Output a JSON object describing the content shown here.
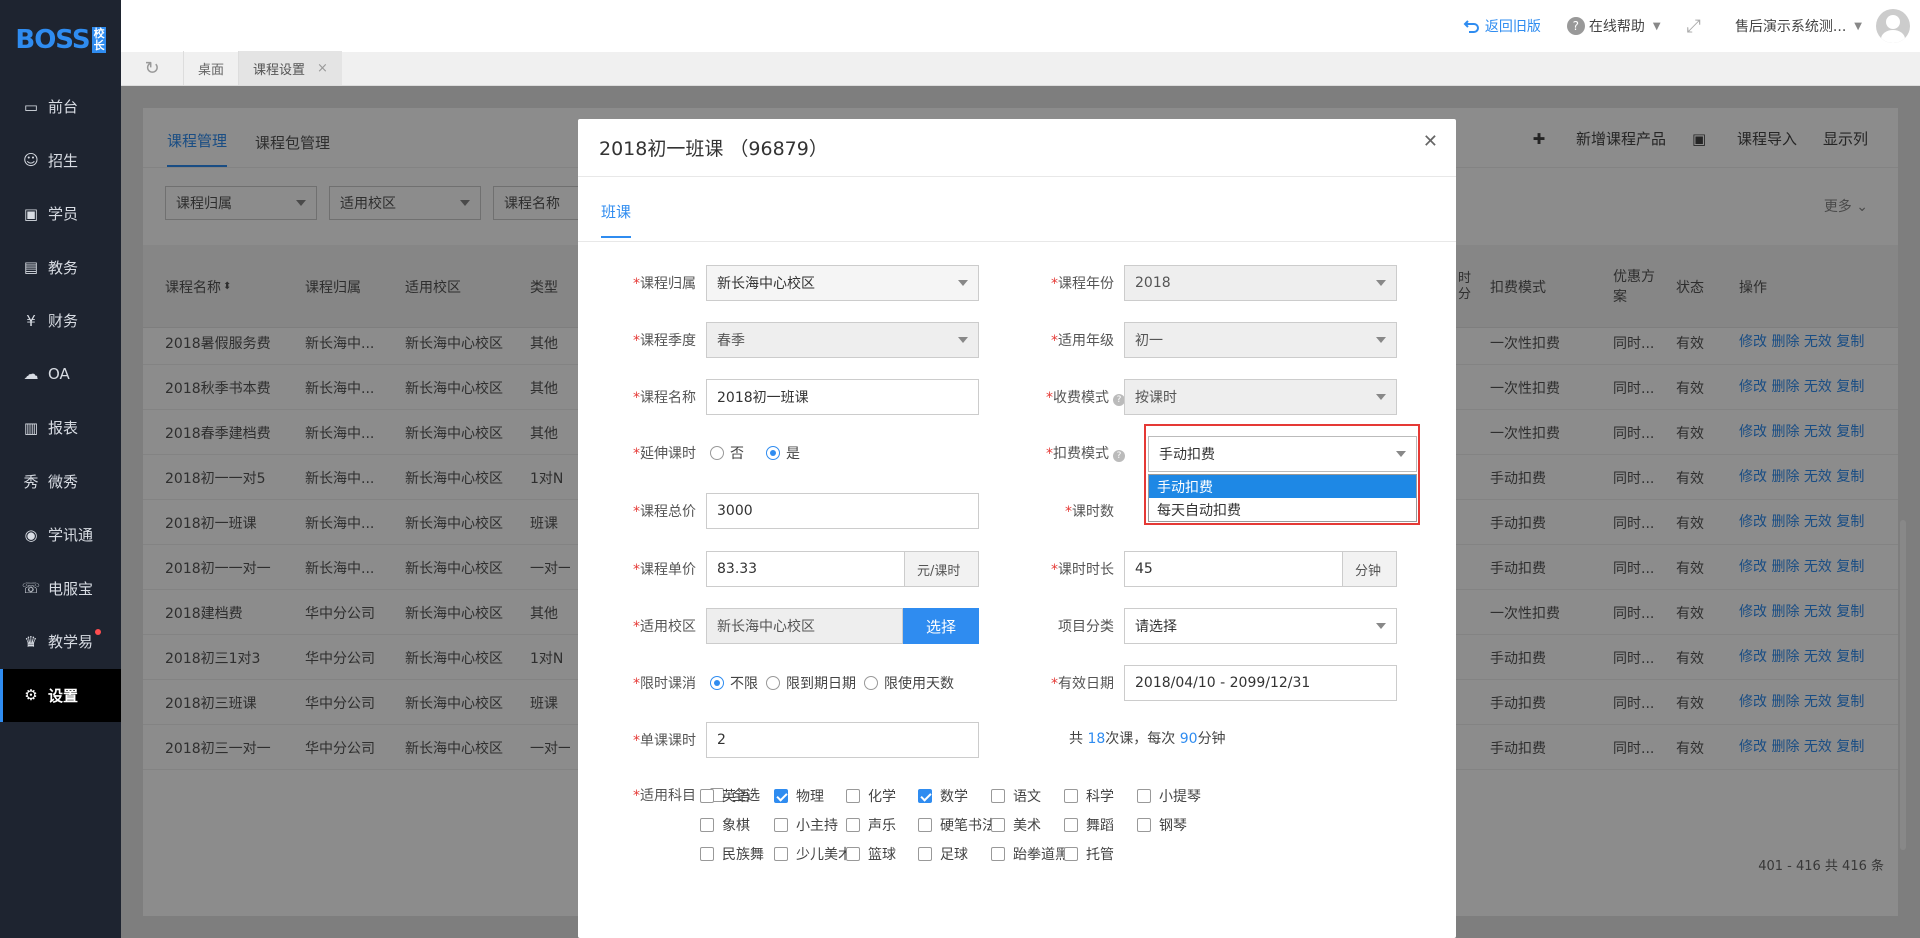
{
  "brand": {
    "logo": "BOSS",
    "logo_sub": "校长"
  },
  "sidebar": {
    "items": [
      {
        "label": "前台",
        "icon": "calendar-icon"
      },
      {
        "label": "招生",
        "icon": "user-add-icon"
      },
      {
        "label": "学员",
        "icon": "id-card-icon"
      },
      {
        "label": "教务",
        "icon": "book-icon"
      },
      {
        "label": "财务",
        "icon": "yen-icon"
      },
      {
        "label": "OA",
        "icon": "cloud-icon"
      },
      {
        "label": "报表",
        "icon": "bar-chart-icon"
      },
      {
        "label": "微秀",
        "icon": "xiu-icon"
      },
      {
        "label": "学讯通",
        "icon": "location-icon"
      },
      {
        "label": "电服宝",
        "icon": "phone-icon"
      },
      {
        "label": "教学易",
        "icon": "graduation-icon"
      },
      {
        "label": "设置",
        "icon": "gear-icon"
      }
    ]
  },
  "topbar": {
    "back": "返回旧版",
    "help": "在线帮助",
    "user": "售后演示系统测..."
  },
  "tabs": [
    {
      "label": "桌面"
    },
    {
      "label": "课程设置"
    }
  ],
  "content": {
    "tabs": [
      "课程管理",
      "课程包管理"
    ],
    "tools": [
      "新增课程产品",
      "课程导入",
      "显示列"
    ],
    "filters": [
      "课程归属",
      "适用校区",
      "课程名称"
    ],
    "more": "更多",
    "columns": [
      "课程名称",
      "课程归属",
      "适用校区",
      "类型",
      "时分",
      "扣费模式",
      "优惠方案",
      "状态",
      "操作"
    ],
    "rows": [
      [
        "2018暑假服务费",
        "新长海中...",
        "新长海中心校区",
        "其他",
        "一次性扣费",
        "同时...",
        "有效"
      ],
      [
        "2018秋季书本费",
        "新长海中...",
        "新长海中心校区",
        "其他",
        "一次性扣费",
        "同时...",
        "有效"
      ],
      [
        "2018春季建档费",
        "新长海中...",
        "新长海中心校区",
        "其他",
        "一次性扣费",
        "同时...",
        "有效"
      ],
      [
        "2018初一一对5",
        "新长海中...",
        "新长海中心校区",
        "1对N",
        "手动扣费",
        "同时...",
        "有效"
      ],
      [
        "2018初一班课",
        "新长海中...",
        "新长海中心校区",
        "班课",
        "手动扣费",
        "同时...",
        "有效"
      ],
      [
        "2018初一一对一",
        "新长海中...",
        "新长海中心校区",
        "一对一",
        "手动扣费",
        "同时...",
        "有效"
      ],
      [
        "2018建档费",
        "华中分公司",
        "新长海中心校区",
        "其他",
        "一次性扣费",
        "同时...",
        "有效"
      ],
      [
        "2018初三1对3",
        "华中分公司",
        "新长海中心校区",
        "1对N",
        "手动扣费",
        "同时...",
        "有效"
      ],
      [
        "2018初三班课",
        "华中分公司",
        "新长海中心校区",
        "班课",
        "手动扣费",
        "同时...",
        "有效"
      ],
      [
        "2018初三一对一",
        "华中分公司",
        "新长海中心校区",
        "一对一",
        "手动扣费",
        "同时...",
        "有效"
      ]
    ],
    "ops": "修改 删除 无效 复制",
    "pager": "401 - 416   共 416 条"
  },
  "modal": {
    "title": "2018初一班课 （96879）",
    "tab": "班课",
    "fields": {
      "owner": {
        "label": "课程归属",
        "value": "新长海中心校区"
      },
      "year": {
        "label": "课程年份",
        "value": "2018"
      },
      "season": {
        "label": "课程季度",
        "value": "春季"
      },
      "grade": {
        "label": "适用年级",
        "value": "初一"
      },
      "name": {
        "label": "课程名称",
        "value": "2018初一班课"
      },
      "fee_mode": {
        "label": "收费模式",
        "value": "按课时"
      },
      "extend": {
        "label": "延伸课时",
        "options": [
          "否",
          "是"
        ],
        "selected": "是"
      },
      "deduct": {
        "label": "扣费模式",
        "value": "手动扣费",
        "options": [
          "手动扣费",
          "每天自动扣费"
        ],
        "highlighted": "手动扣费"
      },
      "total": {
        "label": "课程总价",
        "value": "3000"
      },
      "hours": {
        "label": "课时数",
        "value": ""
      },
      "unit_price": {
        "label": "课程单价",
        "value": "83.33",
        "addon": "元/课时"
      },
      "duration": {
        "label": "课时时长",
        "value": "45",
        "addon": "分钟"
      },
      "campus": {
        "label": "适用校区",
        "value": "新长海中心校区",
        "button": "选择"
      },
      "category": {
        "label": "项目分类",
        "value": "请选择"
      },
      "limit": {
        "label": "限时课消",
        "options": [
          "不限",
          "限到期日期",
          "限使用天数"
        ],
        "selected": "不限"
      },
      "valid": {
        "label": "有效日期",
        "value": "2018/04/10 - 2099/12/31"
      },
      "single": {
        "label": "单课课时",
        "value": "2"
      },
      "summary": {
        "prefix": "共 ",
        "count": "18",
        "mid": "次课，每次 ",
        "minutes": "90",
        "suffix": "分钟"
      },
      "subjects": {
        "label": "适用科目",
        "all": "全选",
        "items": [
          {
            "name": "英语",
            "checked": false
          },
          {
            "name": "物理",
            "checked": true
          },
          {
            "name": "化学",
            "checked": false
          },
          {
            "name": "数学",
            "checked": true
          },
          {
            "name": "语文",
            "checked": false
          },
          {
            "name": "科学",
            "checked": false
          },
          {
            "name": "小提琴",
            "checked": false
          },
          {
            "name": "象棋",
            "checked": false
          },
          {
            "name": "小主持",
            "checked": false
          },
          {
            "name": "声乐",
            "checked": false
          },
          {
            "name": "硬笔书法",
            "checked": false
          },
          {
            "name": "美术",
            "checked": false
          },
          {
            "name": "舞蹈",
            "checked": false
          },
          {
            "name": "钢琴",
            "checked": false
          },
          {
            "name": "民族舞",
            "checked": false
          },
          {
            "name": "少儿美术",
            "checked": false
          },
          {
            "name": "篮球",
            "checked": false
          },
          {
            "name": "足球",
            "checked": false
          },
          {
            "name": "跆拳道黑",
            "checked": false
          },
          {
            "name": "托管",
            "checked": false
          }
        ]
      }
    }
  },
  "colors": {
    "accent": "#2f8cf0",
    "sidebar": "#1e2430",
    "highlight_border": "#e53935"
  }
}
